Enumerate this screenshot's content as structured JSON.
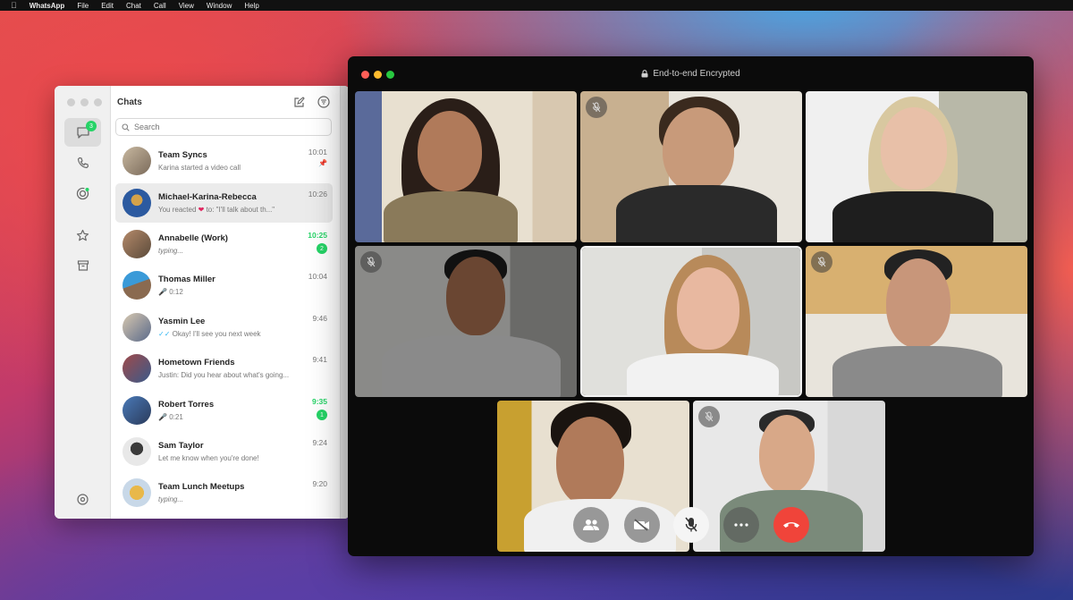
{
  "menubar": {
    "app_name": "WhatsApp",
    "menus": [
      "File",
      "Edit",
      "Chat",
      "Call",
      "View",
      "Window",
      "Help"
    ]
  },
  "sidebar": {
    "chats_badge": "3",
    "items": [
      "chats-icon",
      "calls-icon",
      "status-icon",
      "starred-icon",
      "archive-icon",
      "settings-icon"
    ]
  },
  "chat_list": {
    "title": "Chats",
    "search_placeholder": "Search",
    "chats": [
      {
        "name": "Team Syncs",
        "preview": "Karina started a video call",
        "time": "10:01",
        "pinned": true
      },
      {
        "name": "Michael-Karina-Rebecca",
        "preview_prefix": "You reacted ",
        "preview_suffix": " to: \"I'll talk about th...\"",
        "time": "10:26",
        "selected": true
      },
      {
        "name": "Annabelle (Work)",
        "preview": "typing...",
        "time": "10:25",
        "unread": "2"
      },
      {
        "name": "Thomas Miller",
        "preview": "0:12",
        "time": "10:04"
      },
      {
        "name": "Yasmin Lee",
        "preview": "Okay! I'll see you next week",
        "time": "9:46"
      },
      {
        "name": "Hometown Friends",
        "preview": "Justin: Did you hear about what's going...",
        "time": "9:41"
      },
      {
        "name": "Robert Torres",
        "preview": "0:21",
        "time": "9:35",
        "unread": "1"
      },
      {
        "name": "Sam Taylor",
        "preview": "Let me know when you're done!",
        "time": "9:24"
      },
      {
        "name": "Team Lunch Meetups",
        "preview": "typing...",
        "time": "9:20"
      }
    ]
  },
  "call": {
    "title": "End-to-end Encrypted",
    "controls": [
      "participants-icon",
      "camera-off-icon",
      "microphone-muted-icon",
      "more-icon",
      "end-call-icon"
    ]
  },
  "colors": {
    "accent_green": "#25d366",
    "end_call_red": "#f0443a",
    "voice_blue": "#34b7f1"
  }
}
